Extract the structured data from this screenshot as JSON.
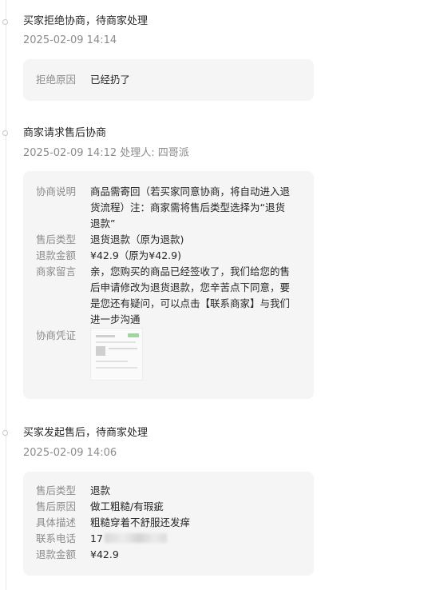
{
  "events": [
    {
      "title": "买家拒绝协商，待商家处理",
      "meta": "2025-02-09 14:14",
      "rows": [
        {
          "label": "拒绝原因",
          "value": "已经扔了"
        }
      ]
    },
    {
      "title": "商家请求售后协商",
      "meta": "2025-02-09 14:12 处理人: 四哥派",
      "rows": [
        {
          "label": "协商说明",
          "value": "商品需寄回（若买家同意协商，将自动进入退货流程）注：商家需将售后类型选择为“退货退款”"
        },
        {
          "label": "售后类型",
          "value": "退货退款（原为退款)"
        },
        {
          "label": "退款金额",
          "value": "¥42.9（原为¥42.9)"
        },
        {
          "label": "商家留言",
          "value": "亲，您购买的商品已经签收了，我们给您的售后申请修改为退货退款，您辛苦点下同意，要是您还有疑问，可以点击【联系商家】与我们进一步沟通"
        },
        {
          "label": "协商凭证",
          "value": ""
        }
      ]
    },
    {
      "title": "买家发起售后，待商家处理",
      "meta": "2025-02-09 14:06",
      "rows": [
        {
          "label": "售后类型",
          "value": "退款"
        },
        {
          "label": "售后原因",
          "value": "做工粗糙/有瑕疵"
        },
        {
          "label": "具体描述",
          "value": "粗糙穿着不舒服还发痒"
        },
        {
          "label": "联系电话",
          "value": "17"
        },
        {
          "label": "退款金额",
          "value": "¥42.9"
        }
      ]
    }
  ]
}
